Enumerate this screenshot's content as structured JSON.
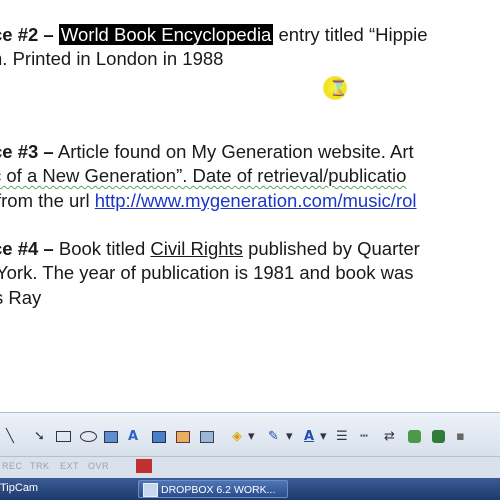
{
  "document": {
    "source2": {
      "label": "ce #2 –",
      "title_highlight": "World Book Encyclopedia",
      "rest": " entry titled “Hippie",
      "line2": "n.  Printed in London in 1988"
    },
    "source3": {
      "label": "ce #3 –",
      "rest": " Article found on My Generation website.  Art",
      "line2": "c of a New Generation”.  Date of retrieval/publicatio",
      "line3_prefix": "from the url ",
      "url": "http://www.mygeneration.com/music/rol"
    },
    "source4": {
      "label": "ce #4 –",
      "rest_before": " Book titled ",
      "book_title": "Civil Rights",
      "rest_after": " published by Quarter",
      "line2": "York.  The year of publication is 1981 and book was",
      "line3": "s Ray"
    },
    "cursor_icon": "hourglass-icon"
  },
  "toolbar": {
    "icons": [
      "line-tool-icon",
      "arrow-tool-icon",
      "rectangle-tool-icon",
      "ellipse-tool-icon",
      "image-tool-icon",
      "fontwork-icon",
      "gallery-icon",
      "picture-icon",
      "fill-color-icon",
      "line-color-icon",
      "font-color-icon",
      "line-style-icon",
      "dash-style-icon",
      "arrow-style-icon",
      "shadow-icon",
      "3d-icon"
    ],
    "fill_arrow": "▾",
    "line_arrow": "▾",
    "font_arrow": "▾"
  },
  "status": {
    "rec": "REC",
    "trk": "TRK",
    "ext": "EXT",
    "ovr": "OVR"
  },
  "taskbar": {
    "left_label": "TipCam",
    "window_button": "DROPBOX 6.2 WORK..."
  },
  "colors": {
    "link": "#1b36c8",
    "highlight": "#000000",
    "taskbar": "#2a4d8b"
  }
}
